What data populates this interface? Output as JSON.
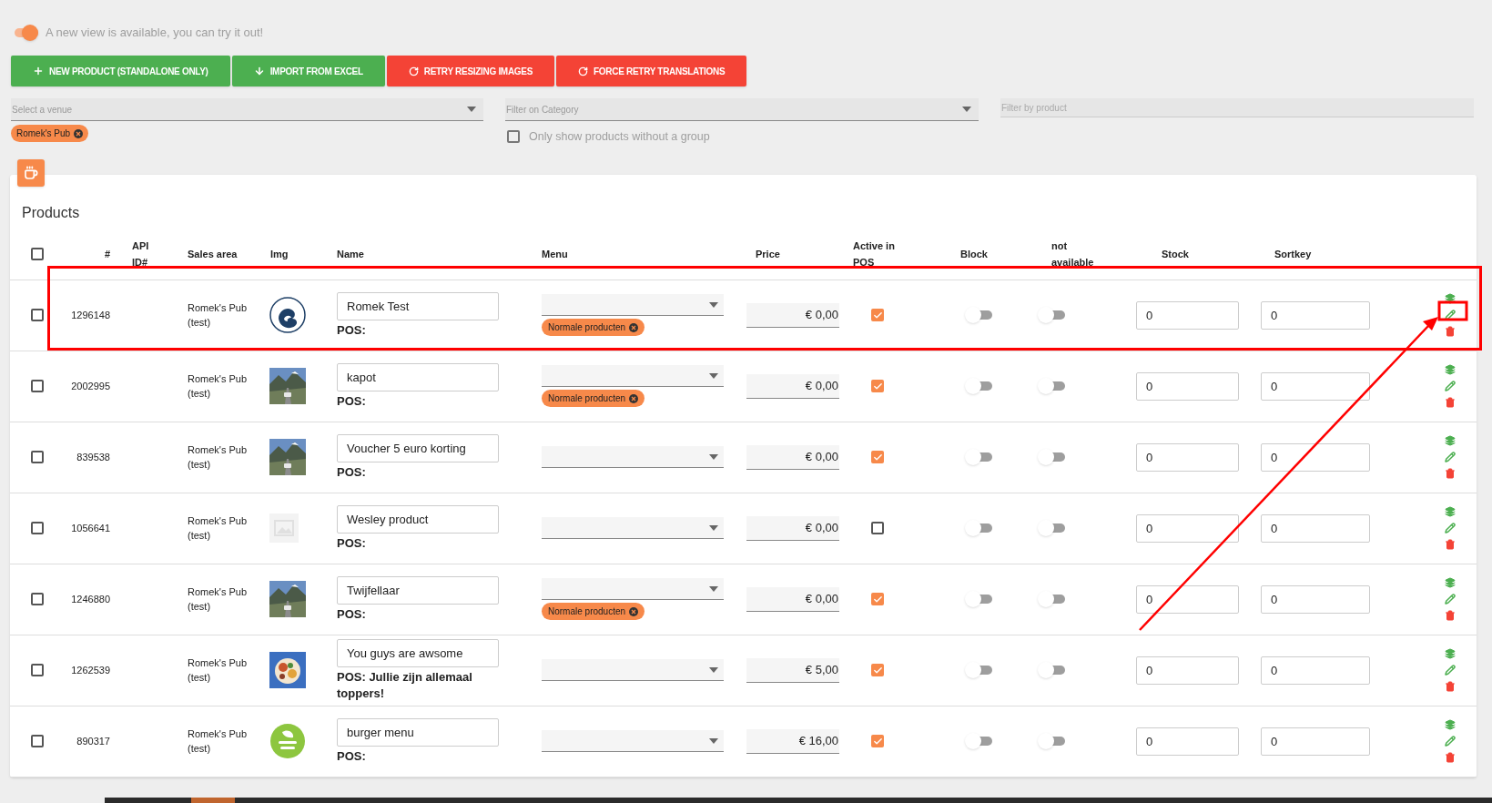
{
  "new_view": {
    "on": true,
    "text": "A new view is available, you can try it out!"
  },
  "actions": [
    {
      "kind": "add",
      "label": "NEW PRODUCT (STANDALONE ONLY)"
    },
    {
      "kind": "import",
      "label": "IMPORT FROM EXCEL"
    },
    {
      "kind": "retry",
      "label": "RETRY RESIZING IMAGES"
    },
    {
      "kind": "retry",
      "label": "FORCE RETRY TRANSLATIONS"
    }
  ],
  "filters": {
    "venue": {
      "placeholder": "Select a venue",
      "chips": [
        "Romek's Pub"
      ]
    },
    "category": {
      "placeholder": "Filter on Category"
    },
    "no_group": {
      "label": "Only show products without a group",
      "checked": false
    },
    "product": {
      "placeholder": "Filter by product"
    }
  },
  "products": {
    "title": "Products",
    "all_checked": false,
    "columns": [
      "#",
      "API ID#",
      "Sales area",
      "Img",
      "Name",
      "Menu",
      "Price",
      "Active in POS",
      "Block",
      "not available",
      "Stock",
      "Sortkey"
    ],
    "rows": [
      {
        "selected": false,
        "highlighted": true,
        "id": "1296148",
        "sales_area": "Romek's Pub (test)",
        "image": {
          "kind": "logo"
        },
        "name": "Romek Test",
        "pos": "POS:",
        "menu_chips": [
          "Normale producten"
        ],
        "price": "€ 0,00",
        "active": true,
        "block": false,
        "not_available": false,
        "stock": "0",
        "sortkey": "0"
      },
      {
        "selected": false,
        "highlighted": false,
        "id": "2002995",
        "sales_area": "Romek's Pub (test)",
        "image": {
          "kind": "road"
        },
        "name": "kapot",
        "pos": "POS:",
        "menu_chips": [
          "Normale producten"
        ],
        "price": "€ 0,00",
        "active": true,
        "block": false,
        "not_available": false,
        "stock": "0",
        "sortkey": "0"
      },
      {
        "selected": false,
        "highlighted": false,
        "id": "839538",
        "sales_area": "Romek's Pub (test)",
        "image": {
          "kind": "road"
        },
        "name": "Voucher 5 euro korting",
        "pos": "POS:",
        "menu_chips": [],
        "price": "€ 0,00",
        "active": true,
        "block": false,
        "not_available": false,
        "stock": "0",
        "sortkey": "0"
      },
      {
        "selected": false,
        "highlighted": false,
        "id": "1056641",
        "sales_area": "Romek's Pub (test)",
        "image": {
          "kind": "placeholder"
        },
        "name": "Wesley product",
        "pos": "POS:",
        "menu_chips": [],
        "price": "€ 0,00",
        "active": false,
        "block": false,
        "not_available": false,
        "stock": "0",
        "sortkey": "0"
      },
      {
        "selected": false,
        "highlighted": false,
        "id": "1246880",
        "sales_area": "Romek's Pub (test)",
        "image": {
          "kind": "road"
        },
        "name": "Twijfellaar",
        "pos": "POS:",
        "menu_chips": [
          "Normale producten"
        ],
        "price": "€ 0,00",
        "active": true,
        "block": false,
        "not_available": false,
        "stock": "0",
        "sortkey": "0"
      },
      {
        "selected": false,
        "highlighted": false,
        "id": "1262539",
        "sales_area": "Romek's Pub (test)",
        "image": {
          "kind": "food"
        },
        "name": "You guys are awsome",
        "pos": "POS: Jullie zijn allemaal toppers!",
        "menu_chips": [],
        "price": "€ 5,00",
        "active": true,
        "block": false,
        "not_available": false,
        "stock": "0",
        "sortkey": "0"
      },
      {
        "selected": false,
        "highlighted": false,
        "id": "890317",
        "sales_area": "Romek's Pub (test)",
        "image": {
          "kind": "badge"
        },
        "name": "burger menu",
        "pos": "POS:",
        "menu_chips": [],
        "price": "€ 16,00",
        "active": true,
        "block": false,
        "not_available": false,
        "stock": "0",
        "sortkey": "0"
      }
    ]
  }
}
